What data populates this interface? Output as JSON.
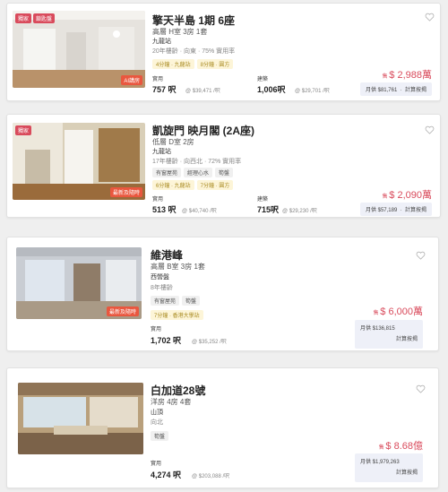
{
  "listings": [
    {
      "tags": [
        "獨家",
        "鎖匙盤"
      ],
      "badge": "AI講房",
      "title": "擎天半島 1期 6座",
      "subtitle": "高層 H室 3房 1套",
      "location": "九龍站",
      "info": "20年樓齡 · 向東 · 75% 實用率",
      "chips": [
        "4分鐘 · 九龍站",
        "8分鐘 · 圓方"
      ],
      "usable_label": "實用",
      "usable_area": "757 呎",
      "usable_price": "@ $39,471 /呎",
      "gross_label": "建築",
      "gross_area": "1,006呎",
      "gross_price": "@ $29,701 /呎",
      "price_prefix": "售",
      "price_value": "$ 2,988萬",
      "mortgage": "月供 $81,761",
      "calc": "計算按揭"
    },
    {
      "tags": [
        "獨家"
      ],
      "badge": "最新及隨時",
      "title": "凱旋門 映月閣 (2A座)",
      "subtitle": "低層 D室 2房",
      "location": "九龍站",
      "info": "17年樓齡 · 向西北 · 72% 實用率",
      "chips": [
        "有窗屋苑",
        "經理心水",
        "筍盤",
        "6分鐘 · 九龍站",
        "7分鐘 · 圓方"
      ],
      "usable_label": "實用",
      "usable_area": "513 呎",
      "usable_price": "@ $40,740 /呎",
      "gross_label": "建築",
      "gross_area": "715呎",
      "gross_price": "@ $29,230 /呎",
      "price_prefix": "售",
      "price_value": "$ 2,090萬",
      "mortgage": "月供 $57,189",
      "calc": "計算按揭"
    },
    {
      "badge": "最新及隨時",
      "title": "維港峰",
      "subtitle": "高層 B室 3房 1套",
      "location": "西營盤",
      "info": "8年樓齡",
      "chips": [
        "有窗屋苑",
        "筍盤",
        "7分鐘 · 香港大學站"
      ],
      "usable_label": "實用",
      "usable_area": "1,702 呎",
      "usable_price": "@ $35,252 /呎",
      "price_prefix": "售",
      "price_value": "$ 6,000萬",
      "mortgage": "月供 $136,815",
      "calc": "計算按揭"
    },
    {
      "title": "白加道28號",
      "subtitle": "洋房 4房 4套",
      "location": "山頂",
      "info": "向北",
      "chips": [
        "筍盤"
      ],
      "usable_label": "實用",
      "usable_area": "4,274 呎",
      "usable_price": "@ $203,088 /呎",
      "price_prefix": "售",
      "price_value": "$ 8.68億",
      "mortgage": "月供 $1,979,263",
      "calc": "計算按揭"
    }
  ],
  "colors": {
    "accent": "#d94b5c",
    "chip_bg": "#fdf5d8",
    "chip_text": "#a98b22",
    "mortgage_bg": "#eef0f8"
  }
}
